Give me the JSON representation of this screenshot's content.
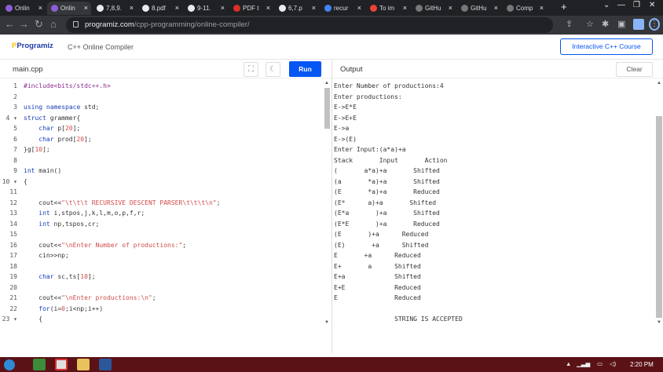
{
  "browser": {
    "tabs": [
      {
        "label": "Onlin",
        "active": false
      },
      {
        "label": "Onlin",
        "active": true
      },
      {
        "label": "7,8,9.",
        "active": false
      },
      {
        "label": "8.pdf",
        "active": false
      },
      {
        "label": "9-11.",
        "active": false
      },
      {
        "label": "PDF t",
        "active": false
      },
      {
        "label": "6,7.p",
        "active": false
      },
      {
        "label": "recur",
        "active": false
      },
      {
        "label": "To im",
        "active": false
      },
      {
        "label": "GitHu",
        "active": false
      },
      {
        "label": "GitHu",
        "active": false
      },
      {
        "label": "Comp",
        "active": false
      }
    ],
    "tab_close": "×",
    "new_tab": "+",
    "url_host": "programiz.com",
    "url_path": "/cpp-programming/online-compiler/",
    "icons": {
      "back": "arrow-left-icon",
      "forward": "arrow-right-icon",
      "reload": "reload-icon",
      "home": "home-icon",
      "lock": "lock-icon",
      "share": "share-icon",
      "star": "star-icon",
      "extensions": "puzzle-icon",
      "sidebar": "sidebar-icon",
      "menu": "kebab-icon"
    }
  },
  "site": {
    "logo_main": "Programiz",
    "subtitle": "C++ Online Compiler",
    "course_button": "Interactive C++ Course"
  },
  "editor": {
    "filename": "main.cpp",
    "run_label": "Run",
    "lines": [
      {
        "n": "1",
        "html": "<span class='pp'>#include&lt;bits/stdc++.h&gt;</span>"
      },
      {
        "n": "2",
        "html": ""
      },
      {
        "n": "3",
        "html": "<span class='kw'>using</span> <span class='kw'>namespace</span> std;"
      },
      {
        "n": "4 ▾",
        "html": "<span class='kw'>struct</span> grammer{"
      },
      {
        "n": "5",
        "html": "    <span class='kw'>char</span> p[<span class='str'>20</span>];"
      },
      {
        "n": "6",
        "html": "    <span class='kw'>char</span> prod[<span class='str'>20</span>];"
      },
      {
        "n": "7",
        "html": "}g[<span class='str'>10</span>];"
      },
      {
        "n": "8",
        "html": ""
      },
      {
        "n": "9",
        "html": "<span class='kw'>int</span> main()"
      },
      {
        "n": "10 ▾",
        "html": "{"
      },
      {
        "n": "11",
        "html": ""
      },
      {
        "n": "12",
        "html": "    cout&lt;&lt;<span class='str'>\"\\t\\t\\t RECURSIVE DESCENT PARSER\\t\\t\\t\\n\"</span>;"
      },
      {
        "n": "13",
        "html": "    <span class='kw'>int</span> i,stpos,j,k,l,m,o,p,f,r;"
      },
      {
        "n": "14",
        "html": "    <span class='kw'>int</span> np,tspos,cr;"
      },
      {
        "n": "15",
        "html": ""
      },
      {
        "n": "16",
        "html": "    cout&lt;&lt;<span class='str'>\"\\nEnter Number of productions:\"</span>;"
      },
      {
        "n": "17",
        "html": "    cin&gt;&gt;np;"
      },
      {
        "n": "18",
        "html": ""
      },
      {
        "n": "19",
        "html": "    <span class='kw'>char</span> sc,ts[<span class='str'>10</span>];"
      },
      {
        "n": "20",
        "html": ""
      },
      {
        "n": "21",
        "html": "    cout&lt;&lt;<span class='str'>\"\\nEnter productions:\\n\"</span>;"
      },
      {
        "n": "22",
        "html": "    <span class='kw'>for</span>(i=<span class='str'>0</span>;i&lt;np;i++)"
      },
      {
        "n": "23 ▾",
        "html": "    {"
      }
    ]
  },
  "output": {
    "label": "Output",
    "clear_label": "Clear",
    "lines": [
      "Enter Number of productions:4",
      "Enter productions:",
      "E->E*E",
      "E->E+E",
      "E->a",
      "E->(E)",
      "Enter Input:(a*a)+a",
      "Stack       Input       Action",
      "(       a*a)+a       Shifted",
      "(a       *a)+a       Shifted",
      "(E       *a)+a       Reduced",
      "(E*      a)+a       Shifted",
      "(E*a       )+a       Shifted",
      "(E*E       )+a       Reduced",
      "(E       )+a      Reduced",
      "(E)       +a      Shifted",
      "E       +a      Reduced",
      "E+       a      Shifted",
      "E+a             Shifted",
      "E+E             Reduced",
      "E               Reduced",
      "",
      "                STRING IS ACCEPTED"
    ]
  },
  "taskbar": {
    "time": "2:20 PM"
  }
}
